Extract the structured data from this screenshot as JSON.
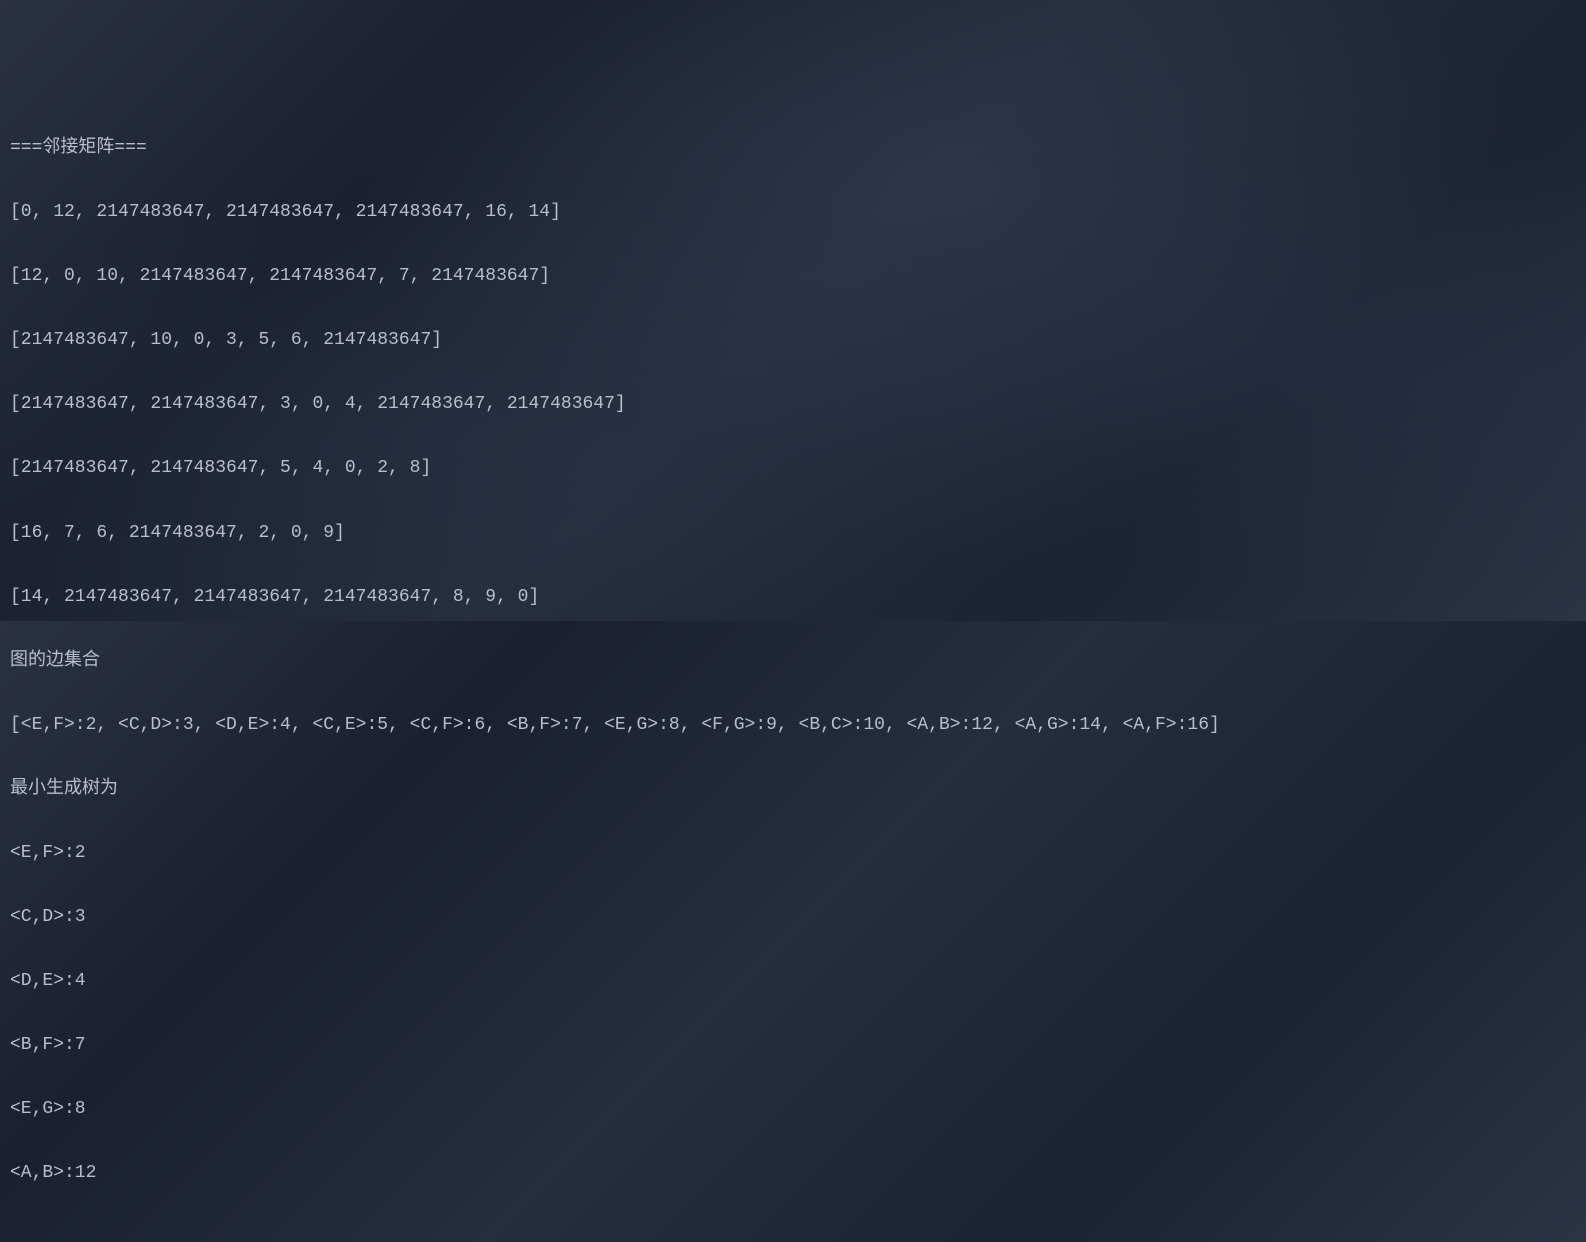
{
  "console": {
    "lines": [
      "===邻接矩阵===",
      "[0, 12, 2147483647, 2147483647, 2147483647, 16, 14]",
      "[12, 0, 10, 2147483647, 2147483647, 7, 2147483647]",
      "[2147483647, 10, 0, 3, 5, 6, 2147483647]",
      "[2147483647, 2147483647, 3, 0, 4, 2147483647, 2147483647]",
      "[2147483647, 2147483647, 5, 4, 0, 2, 8]",
      "[16, 7, 6, 2147483647, 2, 0, 9]",
      "[14, 2147483647, 2147483647, 2147483647, 8, 9, 0]",
      "图的边集合",
      "[<E,F>:2, <C,D>:3, <D,E>:4, <C,E>:5, <C,F>:6, <B,F>:7, <E,G>:8, <F,G>:9, <B,C>:10, <A,B>:12, <A,G>:14, <A,F>:16]",
      "最小生成树为",
      "<E,F>:2",
      "<C,D>:3",
      "<D,E>:4",
      "<B,F>:7",
      "<E,G>:8",
      "<A,B>:12"
    ]
  }
}
